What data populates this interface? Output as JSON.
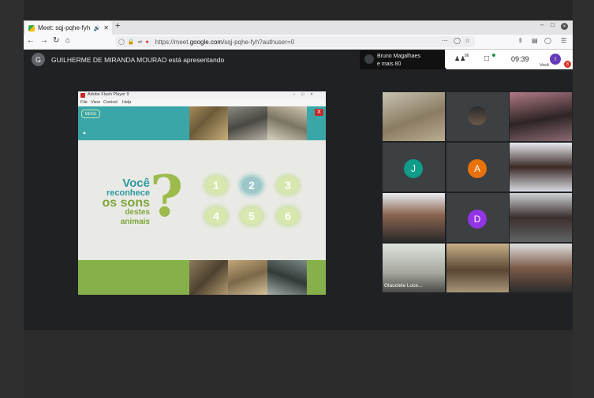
{
  "browser": {
    "tab_title": "Meet: sqj-pqhe-fyh",
    "new_tab": "+",
    "url_prefix": "https://meet.",
    "url_domain": "google.com",
    "url_suffix": "/sqj-pqhe-fyh?authuser=0",
    "window_controls": [
      "–",
      "□",
      "×"
    ],
    "toolbar_icons": [
      "page-actions-icon",
      "pocket-icon",
      "bookmark-star-icon",
      "library-icon",
      "sidebar-icon",
      "account-icon",
      "menu-icon"
    ]
  },
  "meet": {
    "presenter_initial": "G",
    "presenter_text": "GUILHERME DE MIRANDA MOURAO está apresentando",
    "notification_line1": "Bruno Magalhaes",
    "notification_line2": "e mais 80",
    "participants_count": "86",
    "time": "09:39",
    "you_initial": "I",
    "you_label": "Você",
    "badge_count": "8"
  },
  "flash": {
    "window_title": "Adobe Flash Player 9",
    "menu": [
      "File",
      "View",
      "Control",
      "Help"
    ],
    "menu_button": "MENU",
    "close_label": "X",
    "line1": "Você",
    "line2": "reconhece",
    "line3": "os sons",
    "line4": "destes",
    "line5": "animais",
    "question_mark": "?",
    "numbers": [
      "1",
      "2",
      "3",
      "4",
      "5",
      "6"
    ],
    "selected_number": "2"
  },
  "grid": {
    "initial_j": "J",
    "initial_a": "A",
    "initial_d": "D",
    "name_overlay": "Glauciele Luce..."
  },
  "colors": {
    "teal": "#3aa6a8",
    "green": "#86b14a",
    "avatar_j": "#0f9d8a",
    "avatar_a": "#e8710a",
    "avatar_d": "#9334e6"
  }
}
